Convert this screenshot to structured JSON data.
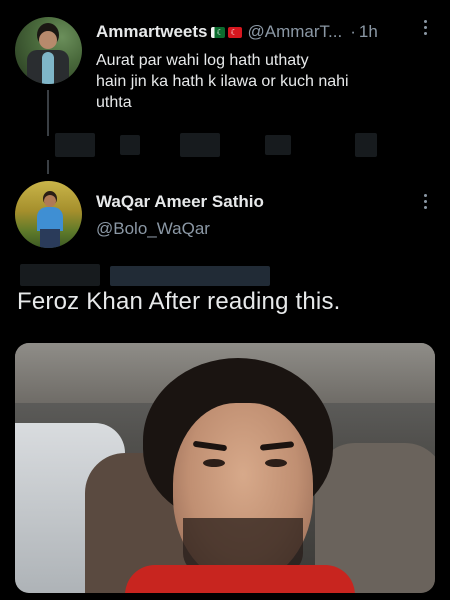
{
  "parent_tweet": {
    "display_name": "Ammartweets",
    "handle": "@AmmarT...",
    "separator": "·",
    "time": "1h",
    "text_lines": [
      "Aurat par wahi log hath uthaty",
      "hain jin ka hath k ilawa or kuch nahi",
      "uthta"
    ],
    "flags": [
      "pakistan-flag",
      "turkey-flag"
    ]
  },
  "reply_tweet": {
    "display_name": "WaQar Ameer Sathio",
    "handle": "@Bolo_WaQar",
    "text": "Feroz Khan After reading this."
  },
  "colors": {
    "background": "#000000",
    "text_primary": "#e7e9ea",
    "text_secondary": "#8b98a5"
  }
}
